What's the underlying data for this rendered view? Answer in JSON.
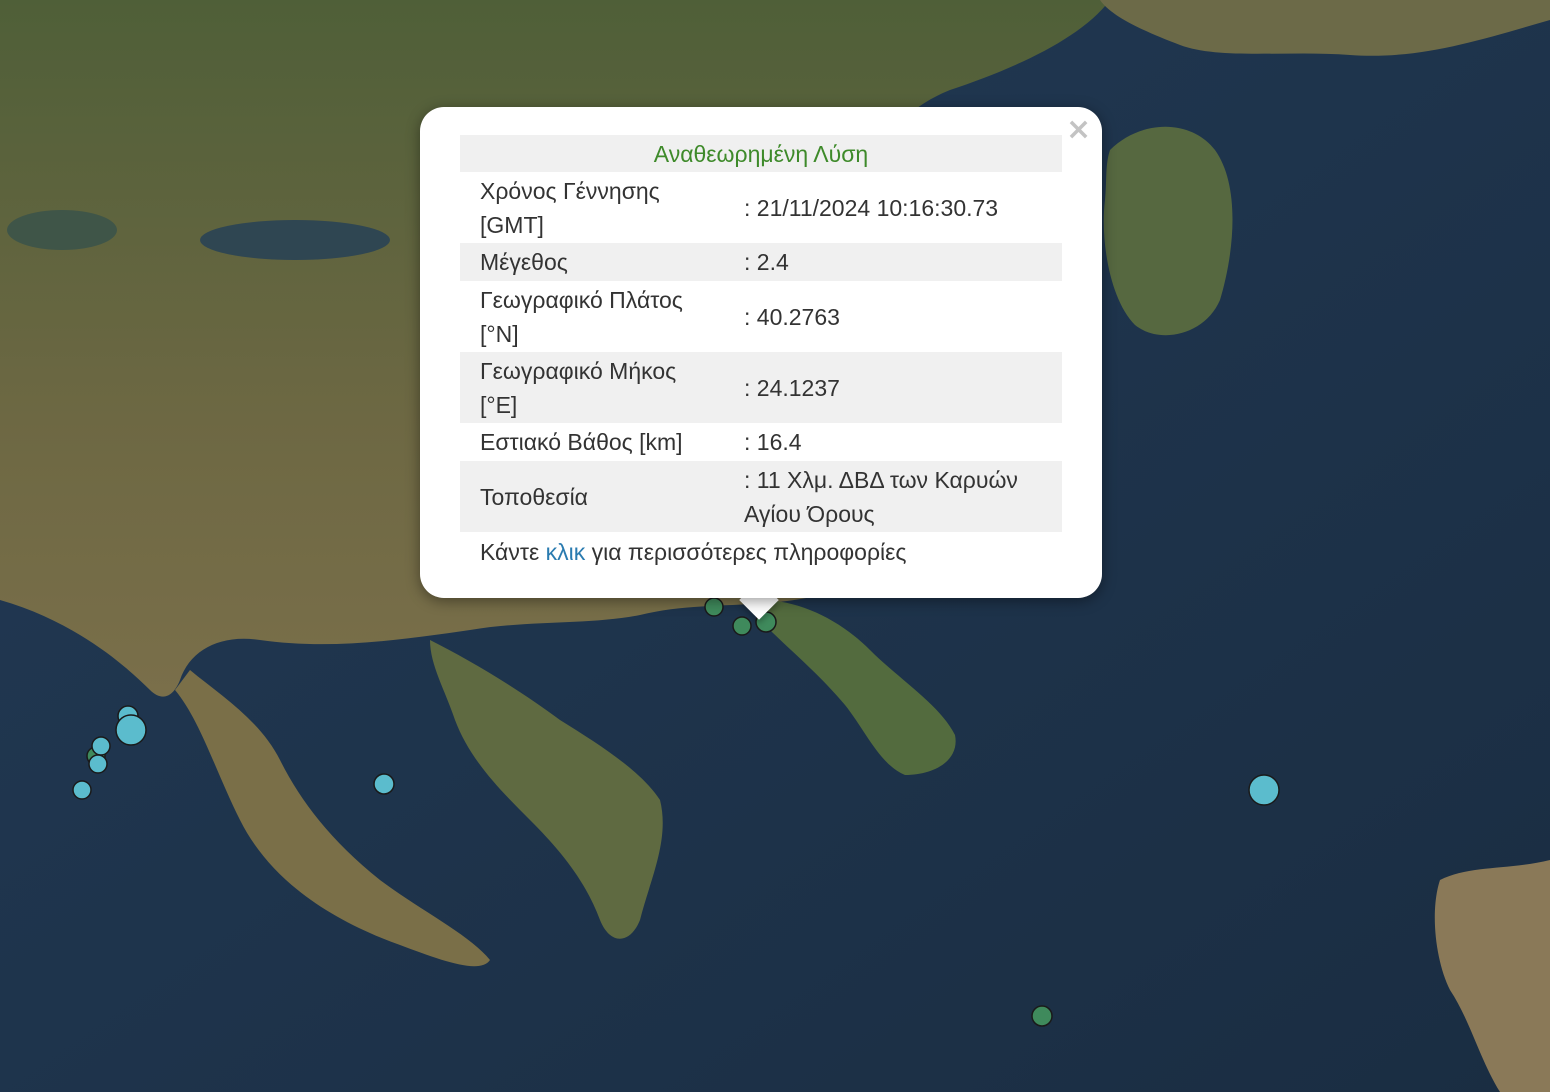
{
  "popup": {
    "close_label": "×",
    "title": "Αναθεωρημένη Λύση",
    "rows": [
      {
        "label": "Χρόνος Γέννησης [GMT]",
        "value": ": 21/11/2024 10:16:30.73"
      },
      {
        "label": "Μέγεθος",
        "value": ": 2.4"
      },
      {
        "label": "Γεωγραφικό Πλάτος [°N]",
        "value": ": 40.2763"
      },
      {
        "label": "Γεωγραφικό Μήκος [°E]",
        "value": ": 24.1237"
      },
      {
        "label": "Εστιακό Βάθος [km]",
        "value": ": 16.4"
      },
      {
        "label": "Τοποθεσία",
        "value": ": 11 Χλμ. ΔΒΔ των Καρυών Αγίου Όρους"
      }
    ],
    "footer_prefix": "Κάντε ",
    "footer_link": "κλικ",
    "footer_suffix": " για περισσότερες πληροφορίες"
  },
  "colors": {
    "sea": "#1b2f44",
    "land": "#6b6a45",
    "marker_green": "#3f8a5c",
    "marker_cyan": "#5bbccd",
    "title_green": "#3e8a2a",
    "link_blue": "#2a7bb0"
  }
}
